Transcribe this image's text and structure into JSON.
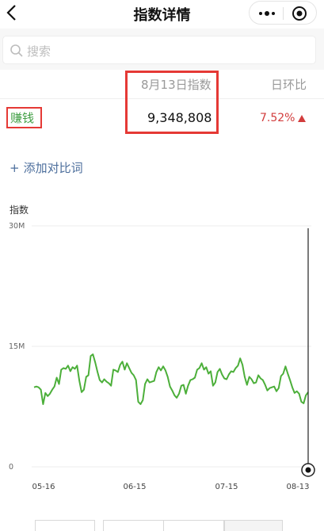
{
  "nav": {
    "title": "指数详情",
    "back_icon": "chevron-left-icon",
    "more_icon": "more-dots-icon",
    "close_icon": "target-close-icon"
  },
  "search": {
    "placeholder": "搜索",
    "icon": "search-icon"
  },
  "table": {
    "date_header": "8月13日指数",
    "change_header": "日环比",
    "row": {
      "keyword": "赚钱",
      "value": "9,348,808",
      "change": "7.52%",
      "trend": "up"
    }
  },
  "add_compare": {
    "label": "添加对比词"
  },
  "colors": {
    "line": "#4caf3a",
    "up": "#d23c3c",
    "highlight": "#e53935",
    "keyword": "#43a047",
    "link": "#4c6e9c"
  },
  "chart_data": {
    "type": "line",
    "ylabel": "指数",
    "yticks": [
      "30M",
      "15M",
      "0"
    ],
    "ylim": [
      0,
      30000000
    ],
    "xticks": [
      "05-16",
      "06-15",
      "07-15",
      "08-13"
    ],
    "series": [
      {
        "values": [
          9.9,
          10.0,
          9.9,
          9.6,
          7.8,
          9.2,
          8.8,
          9.1,
          9.6,
          10.0,
          11.1,
          10.3,
          12.1,
          12.3,
          12.2,
          12.6,
          11.9,
          12.4,
          12.2,
          12.6,
          10.7,
          9.3,
          9.6,
          11.2,
          11.4,
          13.8,
          14.0,
          13.0,
          11.8,
          10.8,
          10.5,
          10.9,
          10.6,
          10.4,
          10.1,
          12.1,
          12.0,
          11.8,
          12.7,
          13.1,
          12.1,
          12.9,
          12.3,
          11.7,
          11.4,
          10.8,
          8.1,
          7.8,
          8.3,
          10.3,
          10.9,
          10.5,
          10.6,
          10.7,
          11.8,
          12.4,
          12.0,
          12.5,
          12.0,
          11.2,
          10.0,
          9.5,
          8.9,
          8.6,
          9.1,
          10.1,
          10.2,
          9.1,
          10.1,
          10.8,
          10.9,
          11.1,
          12.1,
          12.3,
          12.9,
          12.1,
          12.4,
          11.6,
          11.9,
          10.1,
          10.5,
          11.8,
          12.2,
          11.5,
          11.0,
          10.9,
          11.5,
          11.9,
          11.8,
          12.3,
          12.6,
          13.5,
          12.7,
          11.2,
          10.2,
          11.2,
          10.9,
          10.4,
          10.5,
          11.4,
          11.0,
          10.8,
          10.2,
          9.5,
          9.8,
          9.9,
          10.0,
          9.4,
          9.8,
          11.3,
          11.6,
          12.5,
          11.6,
          10.8,
          9.9,
          9.2,
          9.4,
          9.1,
          8.1,
          7.9,
          8.9,
          9.3
        ]
      }
    ]
  }
}
